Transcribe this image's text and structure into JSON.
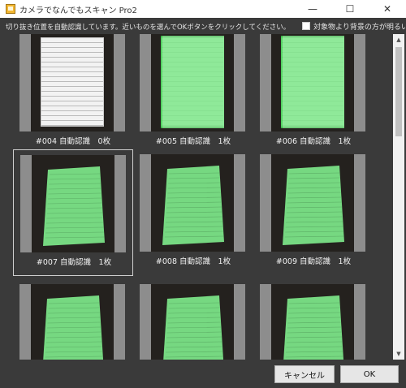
{
  "window": {
    "title": "カメラでなんでもスキャン Pro2",
    "minimize": "—",
    "maximize": "☐",
    "close": "✕"
  },
  "header": {
    "instruction": "切り抜き位置を自動認識しています。近いものを選んでOKボタンをクリックしてください。",
    "checkbox_label": "対象物より背景の方が明るい",
    "checkbox_checked": false
  },
  "grid": {
    "items": [
      {
        "caption": "#004 自動認識　0枚",
        "highlighted": false,
        "selected": false
      },
      {
        "caption": "#005 自動認識　1枚",
        "highlighted": true,
        "selected": false
      },
      {
        "caption": "#006 自動認識　1枚",
        "highlighted": true,
        "selected": false
      },
      {
        "caption": "#007 自動認識　1枚",
        "highlighted": true,
        "selected": true
      },
      {
        "caption": "#008 自動認識　1枚",
        "highlighted": true,
        "selected": false
      },
      {
        "caption": "#009 自動認識　1枚",
        "highlighted": true,
        "selected": false
      },
      {
        "caption": "",
        "highlighted": true,
        "selected": false
      },
      {
        "caption": "",
        "highlighted": true,
        "selected": false
      },
      {
        "caption": "",
        "highlighted": true,
        "selected": false
      }
    ]
  },
  "scrollbar": {
    "up": "▲",
    "down": "▼"
  },
  "buttons": {
    "cancel": "キャンセル",
    "ok": "OK"
  },
  "colors": {
    "highlight": "#7ee88a",
    "background": "#3a3a3a"
  }
}
